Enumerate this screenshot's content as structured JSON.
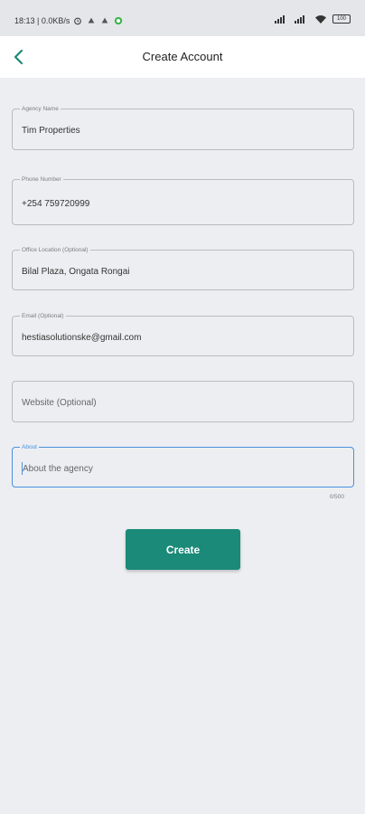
{
  "status_bar": {
    "time_info": "18:13 | 0.0KB/s",
    "battery": "100"
  },
  "header": {
    "title": "Create Account"
  },
  "form": {
    "agency_name": {
      "label": "Agency Name",
      "value": "Tim Properties"
    },
    "phone_number": {
      "label": "Phone Number",
      "value": "+254  759720999"
    },
    "office_location": {
      "label": "Office Location (Optional)",
      "value": "Bilal Plaza, Ongata Rongai"
    },
    "email": {
      "label": "Email (Optional)",
      "value": "hestiasolutionske@gmail.com"
    },
    "website": {
      "placeholder": "Website (Optional)"
    },
    "about": {
      "label": "About",
      "placeholder": "About the agency",
      "counter": "0/500"
    }
  },
  "create_button": {
    "label": "Create"
  },
  "colors": {
    "accent": "#1b8a78",
    "focus": "#4a90e2",
    "background": "#eceef1"
  }
}
